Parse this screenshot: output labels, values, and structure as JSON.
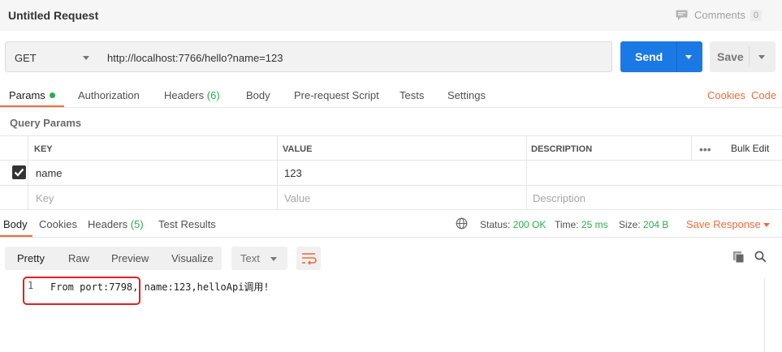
{
  "title": "Untitled Request",
  "comments": {
    "label": "Comments",
    "count": "0"
  },
  "request": {
    "method": "GET",
    "url": "http://localhost:7766/hello?name=123",
    "send_label": "Send",
    "save_label": "Save"
  },
  "request_tabs": {
    "params": "Params",
    "authorization": "Authorization",
    "headers": "Headers",
    "headers_count": "(6)",
    "body": "Body",
    "prerequest": "Pre-request Script",
    "tests": "Tests",
    "settings": "Settings",
    "cookies": "Cookies",
    "code": "Code"
  },
  "query_params": {
    "title": "Query Params",
    "columns": {
      "key": "KEY",
      "value": "VALUE",
      "description": "DESCRIPTION"
    },
    "bulk_edit": "Bulk Edit",
    "rows": [
      {
        "key": "name",
        "value": "123",
        "description": "",
        "checked": true
      }
    ],
    "placeholders": {
      "key": "Key",
      "value": "Value",
      "description": "Description"
    }
  },
  "response_tabs": {
    "body": "Body",
    "cookies": "Cookies",
    "headers": "Headers",
    "headers_count": "(5)",
    "test_results": "Test Results"
  },
  "response_status": {
    "status_label": "Status:",
    "status_value": "200 OK",
    "time_label": "Time:",
    "time_value": "25 ms",
    "size_label": "Size:",
    "size_value": "204 B",
    "save_response": "Save Response"
  },
  "view_modes": [
    "Pretty",
    "Raw",
    "Preview",
    "Visualize"
  ],
  "format": "Text",
  "response_body": {
    "line_number": "1",
    "text": "From port:7798, name:123,helloApi调用!"
  },
  "colors": {
    "accent": "#f26b3a",
    "primary": "#1b79e6",
    "success": "#26b047",
    "highlight": "#e02020"
  }
}
